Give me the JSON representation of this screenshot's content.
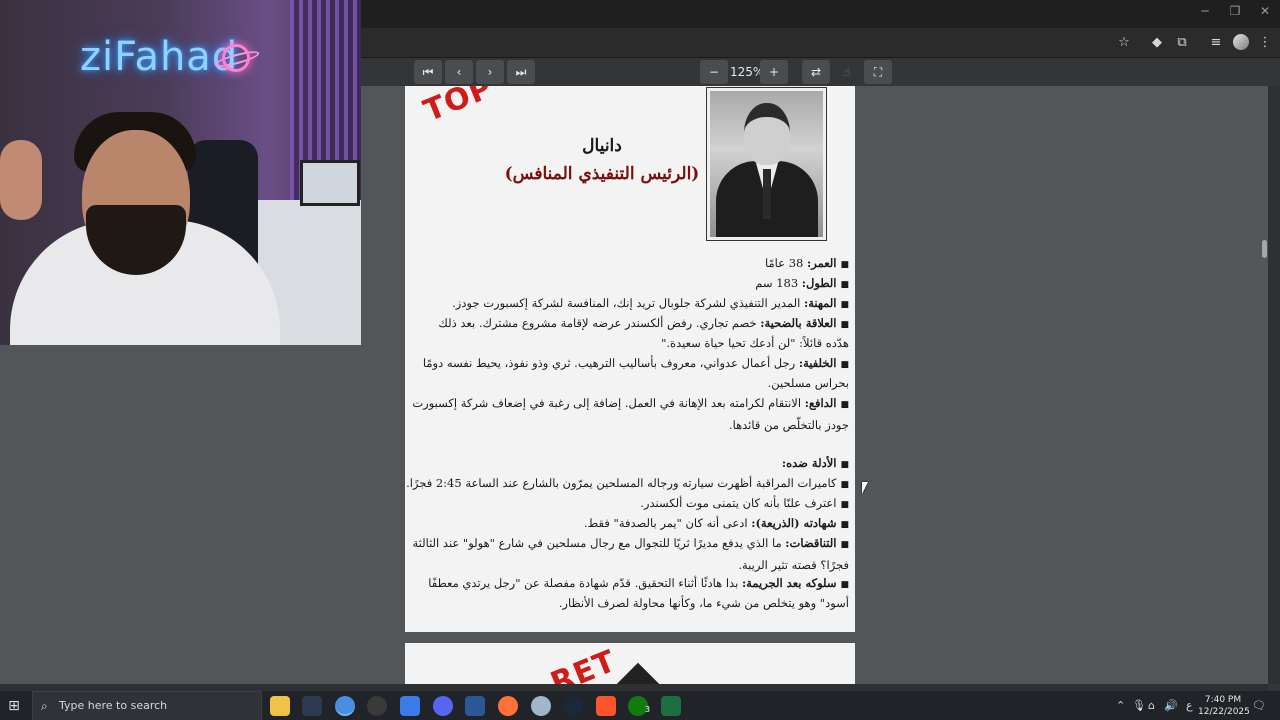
{
  "browser": {
    "bookmark_icon": "star-icon",
    "extension_icons": [
      "diamond-extension-icon",
      "puzzle-extension-icon",
      "media-icon"
    ]
  },
  "pdf_toolbar": {
    "zoom": "125%",
    "buttons": [
      "first-page",
      "prev-page",
      "next-page",
      "last-page",
      "zoom-out",
      "zoom-in",
      "rotate",
      "touch",
      "fit-page"
    ]
  },
  "webcam": {
    "neon_sign": "ziFahad"
  },
  "document": {
    "stamp_top": "TOP",
    "stamp_bottom": "RET",
    "name": "دانيال",
    "role": "(الرئيس التنفيذي المنافس)",
    "lines": [
      {
        "label": "العمر:",
        "text": " 38 عامًا",
        "bullet": true
      },
      {
        "label": "الطول:",
        "text": " 183 سم",
        "bullet": true
      },
      {
        "label": "المهنة:",
        "text": " المدير التنفيذي لشركة جلوبال تريد إنك، المنافسة لشركة إكسبورت جودز.",
        "bullet": true
      },
      {
        "label": "العلاقة بالضحية:",
        "text": " خصم تجاري. رفض ألكسندر عرضه لإقامة مشروع مشترك. بعد ذلك",
        "bullet": true
      },
      {
        "label": "",
        "text": "هدّده قائلاً: \"لن أدعك تحيا حياة سعيدة.\"",
        "bullet": false
      },
      {
        "label": "الخلفية:",
        "text": " رجل أعمال عدواني، معروف بأساليب الترهيب. ثري وذو نفوذ، يحيط نفسه دومًا",
        "bullet": true
      },
      {
        "label": "",
        "text": "بحراس مسلحين.",
        "bullet": false
      },
      {
        "label": "الدافع:",
        "text": " الانتقام لكرامته بعد الإهانة في العمل. إضافة إلى رغبة في إضعاف شركة إكسبورت",
        "bullet": true
      },
      {
        "label": "",
        "text": "جودز بالتخلّص من قائدها.",
        "bullet": false
      },
      {
        "label": "الأدلة ضده:",
        "text": "",
        "bullet": true
      },
      {
        "label": "",
        "text": "كاميرات المراقبة أظهرت سيارته ورجاله المسلحين يمرّون بالشارع عند الساعة 2:45 فجرًا.",
        "bullet": true
      },
      {
        "label": "",
        "text": "اعترف علنًا بأنه كان يتمنى موت ألكسندر.",
        "bullet": true
      },
      {
        "label": "شهادته (الذريعة):",
        "text": " ادعى أنه كان \"يمر بالصدفة\" فقط.",
        "bullet": true
      },
      {
        "label": "التناقضات:",
        "text": " ما الذي يدفع مديرًا ثريًا للتجوال مع رجال مسلحين في شارع \"هولو\" عند الثالثة",
        "bullet": true
      },
      {
        "label": "",
        "text": "فجرًا؟ قصته تثير الريبة.",
        "bullet": false
      },
      {
        "label": "سلوكه بعد الجريمة:",
        "text": " بدا هادئًا أثناء التحقيق. قدّم شهادة مفصلة عن \"رجل يرتدي معطفًا",
        "bullet": true
      },
      {
        "label": "",
        "text": "أسود\" وهو يتخلص من شيء ما، وكأنها محاولة لصرف الأنظار.",
        "bullet": false
      }
    ]
  },
  "taskbar": {
    "search_placeholder": "Type here to search",
    "time": "7:40 PM",
    "date": "12/22/2025",
    "lang": "ع",
    "xbox_badge": "3",
    "apps": [
      "file-explorer",
      "terminal",
      "chrome",
      "obs",
      "store",
      "discord",
      "word",
      "firefox",
      "app",
      "steam",
      "brave",
      "xbox",
      "excel"
    ],
    "colors": {
      "accent": "#76b9ed"
    }
  }
}
